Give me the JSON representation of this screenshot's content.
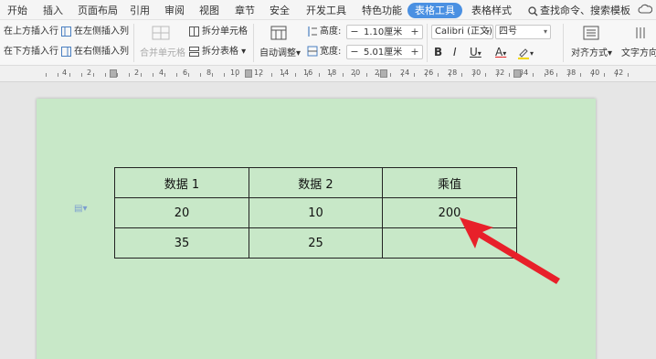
{
  "menu": {
    "items": [
      "开始",
      "插入",
      "页面布局",
      "引用",
      "审阅",
      "视图",
      "章节",
      "安全",
      "开发工具",
      "特色功能",
      "表格工具",
      "表格样式"
    ],
    "active": "表格工具",
    "search": "查找命令、搜索模板"
  },
  "ribbon": {
    "insert_above": "在上方插入行",
    "insert_below": "在下方插入行",
    "insert_left": "在左侧插入列",
    "insert_right": "在右侧插入列",
    "merge_cells": "合并单元格",
    "split_cells": "拆分单元格",
    "split_table": "拆分表格",
    "auto_fit": "自动调整",
    "height_label": "高度:",
    "height_value": "1.10厘米",
    "width_label": "宽度:",
    "width_value": "5.01厘米",
    "font_name": "Calibri (正文)",
    "font_size": "四号",
    "bold": "B",
    "italic": "I",
    "underline": "U",
    "font_color": "A",
    "align": "对齐方式",
    "text_direction": "文字方向"
  },
  "ruler": {
    "labels": [
      "4",
      "2",
      "2",
      "4",
      "6",
      "8",
      "10",
      "12",
      "14",
      "16",
      "18",
      "20",
      "22",
      "24",
      "26",
      "28",
      "30",
      "32",
      "34",
      "36",
      "38",
      "40",
      "42"
    ]
  },
  "table": {
    "headers": [
      "数据 1",
      "数据 2",
      "乘值"
    ],
    "rows": [
      [
        "20",
        "10",
        "200"
      ],
      [
        "35",
        "25",
        ""
      ]
    ]
  },
  "colors": {
    "page": "#c8e8c8",
    "active_tab": "#4a90e2",
    "arrow": "#e8202a"
  }
}
